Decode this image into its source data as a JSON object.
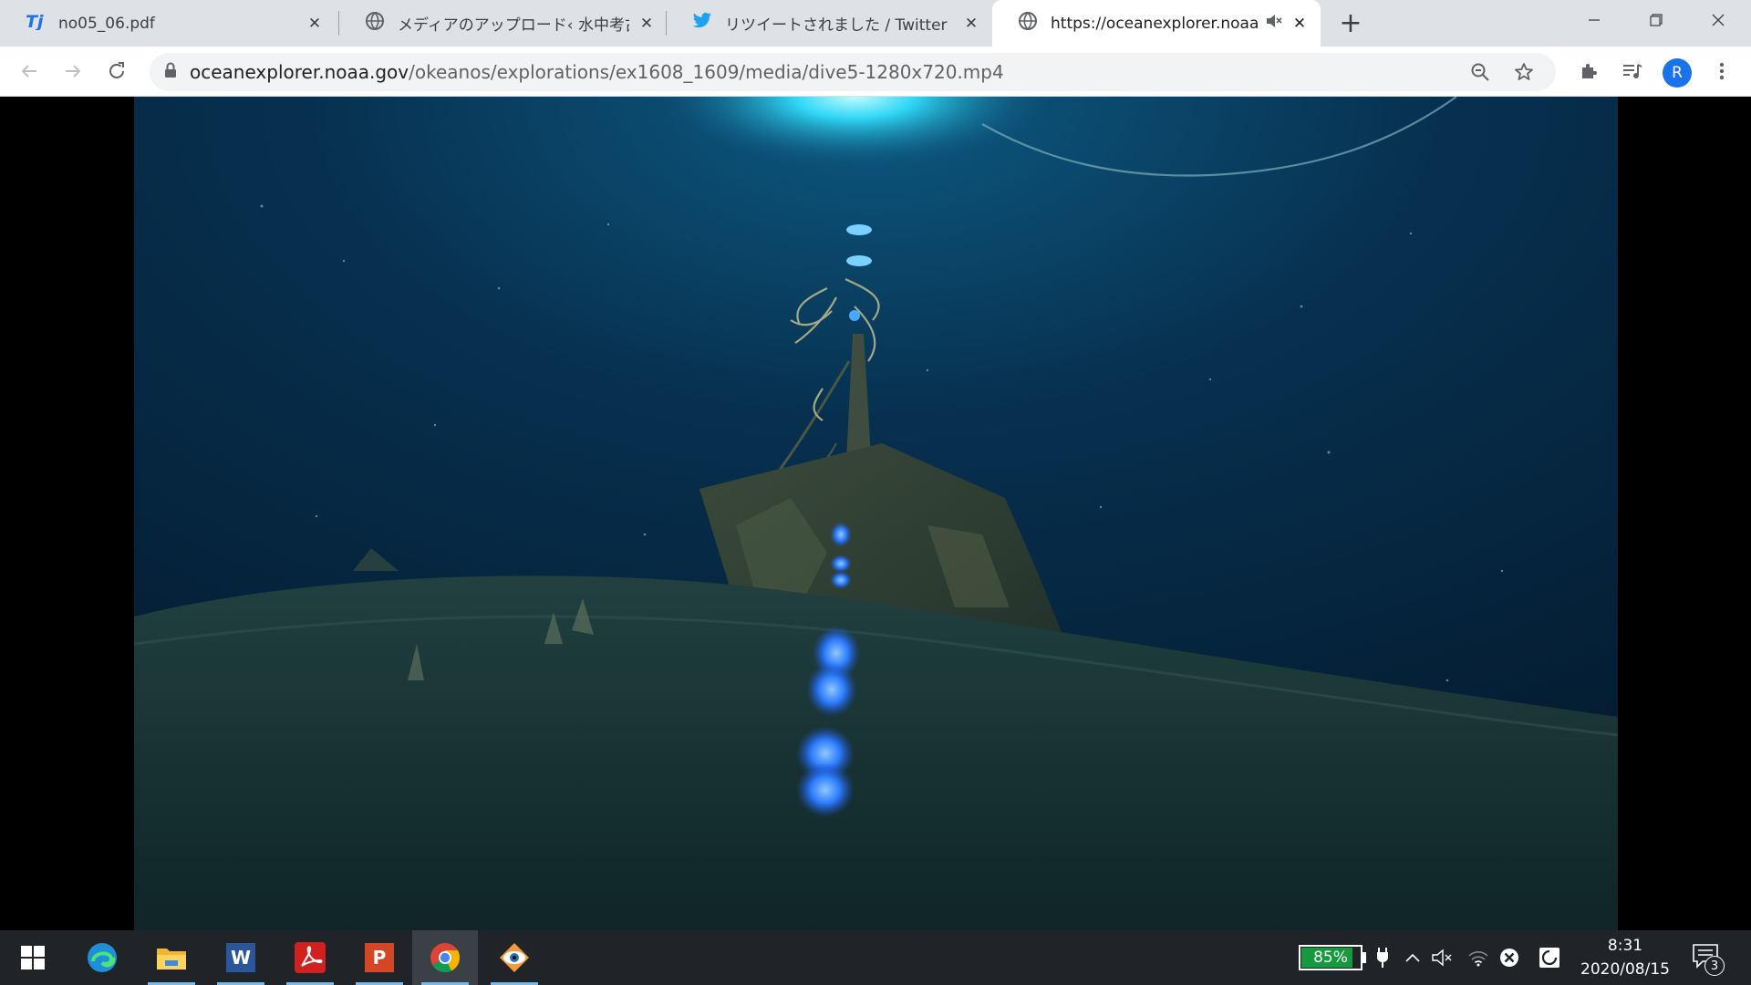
{
  "tabs": [
    {
      "title": "no05_06.pdf",
      "icon": "pdf-viewer-icon",
      "close": "✕"
    },
    {
      "title": "メディアのアップロード‹ 水中考古学／",
      "icon": "globe-icon",
      "close": "✕"
    },
    {
      "title": "リツイートされました / Twitter",
      "icon": "twitter-icon",
      "close": "✕"
    },
    {
      "title": "https://oceanexplorer.noaa.g",
      "icon": "globe-icon",
      "close": "✕",
      "active": true,
      "muted_icon": "speaker-muted-icon"
    }
  ],
  "new_tab_label": "+",
  "window_controls": [
    "minimize-icon",
    "restore-icon",
    "close-icon"
  ],
  "toolbar": {
    "url_host": "oceanexplorer.noaa.gov",
    "url_path": "/okeanos/explorations/ex1608_1609/media/dive5-1280x720.mp4",
    "avatar_letter": "R"
  },
  "video": {
    "subject": "underwater shipwreck footage",
    "colors": {
      "water": "#0a2a4a",
      "light": "#2fd6f5",
      "laser": "#2b7bff"
    }
  },
  "taskbar": {
    "apps": [
      {
        "name": "start",
        "icon": "windows-logo-icon"
      },
      {
        "name": "edge",
        "icon": "edge-icon"
      },
      {
        "name": "file-explorer",
        "icon": "folder-icon",
        "running": true
      },
      {
        "name": "word",
        "icon": "word-icon",
        "running": true,
        "label": "W"
      },
      {
        "name": "acrobat",
        "icon": "acrobat-icon",
        "running": true
      },
      {
        "name": "powerpoint",
        "icon": "powerpoint-icon",
        "running": true,
        "label": "P"
      },
      {
        "name": "chrome",
        "icon": "chrome-icon",
        "running": true,
        "active": true
      },
      {
        "name": "app",
        "icon": "eye-app-icon",
        "running": true
      }
    ],
    "battery": {
      "percent": "85%",
      "level": 0.85,
      "color": "#149a3c"
    },
    "clock": {
      "time": "8:31",
      "date": "2020/08/15"
    },
    "notification_count": "3"
  }
}
